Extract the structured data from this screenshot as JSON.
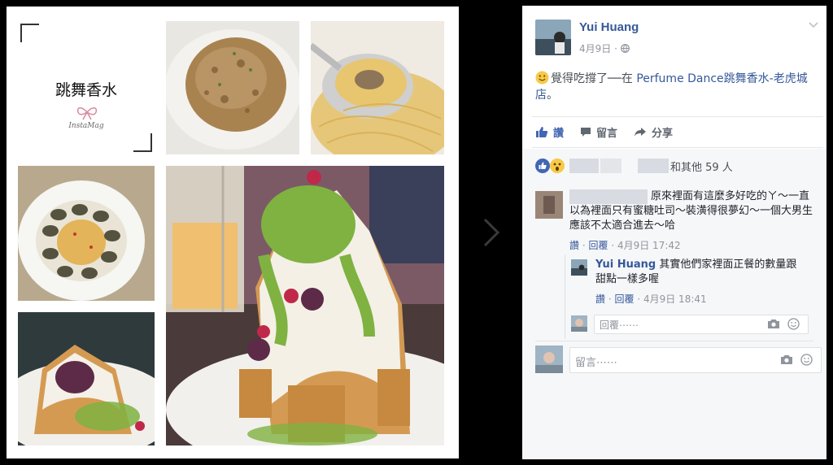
{
  "post": {
    "author": "Yui Huang",
    "date": "4月9日",
    "privacy_icon": "globe-icon",
    "status_prefix": "覺得吃撐了──在 ",
    "status_place": "Perfume Dance跳舞香水-老虎城店",
    "status_suffix": "。",
    "feeling_icon": "smiley-icon"
  },
  "actions": {
    "like": "讚",
    "comment": "留言",
    "share": "分享"
  },
  "reactions": {
    "summary": "和其他 59 人"
  },
  "comments": [
    {
      "text": "原來裡面有這麼多好吃的ㄚ～一直以為裡面只有蜜糖吐司～裝潢得很夢幻～一個大男生應該不太適合進去～哈",
      "like": "讚",
      "reply": "回覆",
      "time": "4月9日 17:42"
    }
  ],
  "reply": {
    "author": "Yui Huang",
    "text": "其實他們家裡面正餐的數量跟甜點一樣多喔",
    "like": "讚",
    "reply": "回覆",
    "time": "4月9日 18:41"
  },
  "reply_box": {
    "placeholder": "回覆⋯⋯"
  },
  "comment_box": {
    "placeholder": "留言⋯⋯"
  },
  "collage": {
    "title": "跳舞香水",
    "brand": "InstaMag"
  },
  "colors": {
    "link": "#365899",
    "like_blue": "#4267b2",
    "matcha": "#7fb241"
  }
}
